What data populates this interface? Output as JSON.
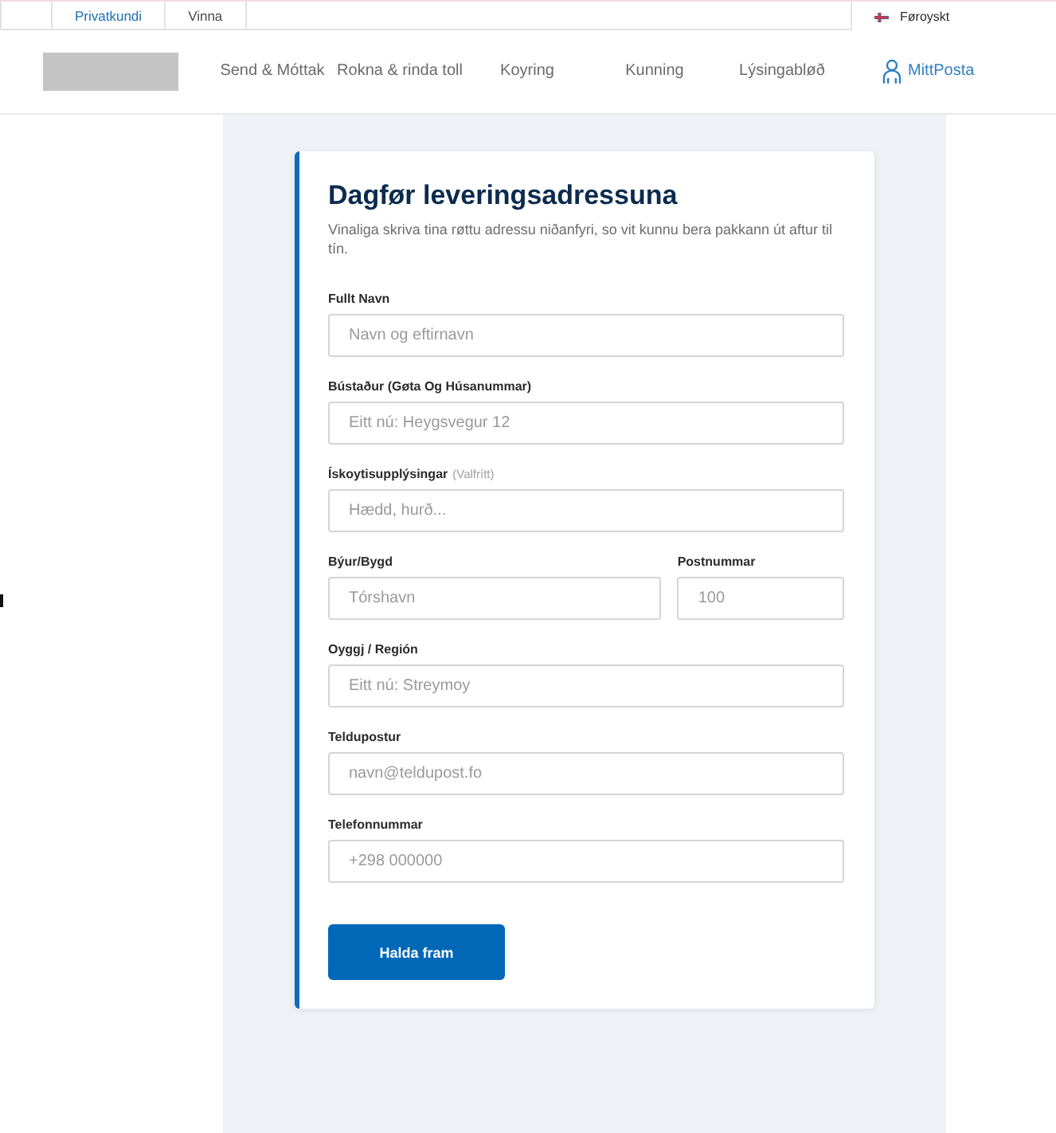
{
  "top_bar": {
    "segments": [
      {
        "label": "Privatkundi",
        "selected": true
      },
      {
        "label": "Vinna",
        "selected": false
      }
    ],
    "language": "Føroyskt"
  },
  "nav": {
    "items": [
      "Send & Móttak",
      "Rokna & rinda toll",
      "Koyring",
      "Kunning",
      "Lýsingabløð"
    ],
    "account": "MittPosta"
  },
  "form": {
    "title": "Dagfør leveringsadressuna",
    "intro": "Vinaliga skriva tina røttu adressu niðanfyri, so vit kunnu bera pakkann út aftur til tín.",
    "rows": [
      {
        "fields": [
          {
            "label": "Fullt Navn",
            "placeholder": "Navn og eftirnavn"
          }
        ]
      },
      {
        "fields": [
          {
            "label": "Bústaður (Gøta Og Húsanummar)",
            "placeholder": "Eitt nú: Heygsvegur 12"
          }
        ]
      },
      {
        "fields": [
          {
            "label": "Ískoytisupplýsingar",
            "hint": "(Valfrítt)",
            "placeholder": "Hædd, hurð..."
          }
        ]
      },
      {
        "fields": [
          {
            "label": "Býur/Bygd",
            "placeholder": "Tórshavn"
          },
          {
            "label": "Postnummar",
            "placeholder": "100"
          }
        ]
      },
      {
        "fields": [
          {
            "label": "Oyggj / Región",
            "placeholder": "Eitt nú: Streymoy"
          }
        ]
      },
      {
        "fields": [
          {
            "label": "Teldupostur",
            "placeholder": "navn@teldupost.fo"
          }
        ]
      },
      {
        "fields": [
          {
            "label": "Telefonnummar",
            "placeholder": "+298 000000"
          }
        ]
      }
    ],
    "submit": "Halda fram"
  }
}
